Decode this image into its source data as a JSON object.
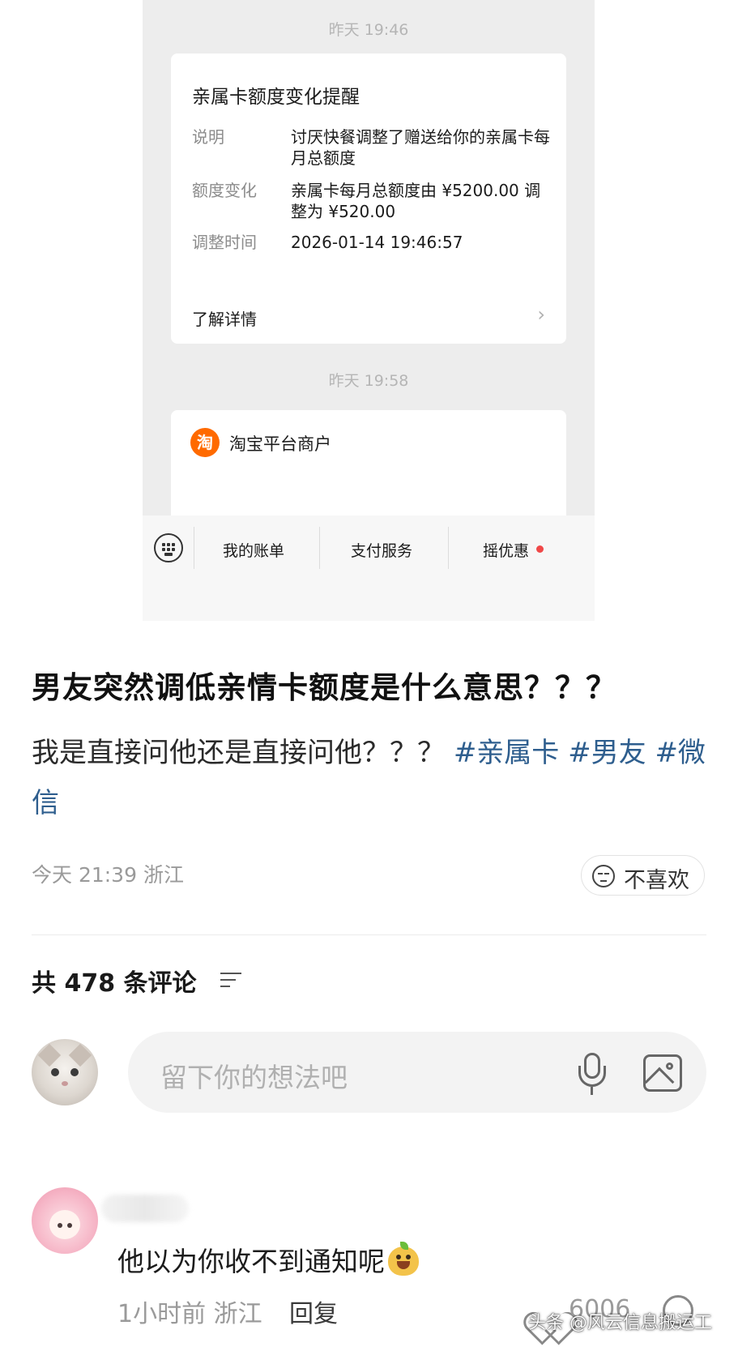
{
  "screenshot": {
    "timestamp1": "昨天 19:46",
    "card": {
      "title": "亲属卡额度变化提醒",
      "rows": [
        {
          "label": "说明",
          "value": "讨厌快餐调整了赠送给你的亲属卡每月总额度"
        },
        {
          "label": "额度变化",
          "value": "亲属卡每月总额度由 ¥5200.00 调整为 ¥520.00"
        },
        {
          "label": "调整时间",
          "value": "2026-01-14 19:46:57"
        }
      ],
      "more_label": "了解详情",
      "more_icon": "chevron-right-icon"
    },
    "timestamp2": "昨天 19:58",
    "merchant": {
      "logo_char": "淘",
      "name": "淘宝平台商户"
    },
    "menu": {
      "keyboard_icon": "keyboard-icon",
      "items": [
        "我的账单",
        "支付服务",
        "摇优惠"
      ]
    }
  },
  "post": {
    "title": "男友突然调低亲情卡额度是什么意思？？？",
    "body": "我是直接问他还是直接问他？？？",
    "tags": [
      "#亲属卡",
      "#男友",
      "#微信"
    ],
    "time": "今天 21:39",
    "location": "浙江",
    "dislike_label": "不喜欢"
  },
  "comments": {
    "count_label": "共 478 条评论",
    "input_placeholder": "留下你的想法吧",
    "items": [
      {
        "text": "他以为你收不到通知呢",
        "time": "1小时前",
        "location": "浙江",
        "reply_label": "回复",
        "likes": "6006"
      }
    ]
  },
  "watermark": "头条 @风云信息搬运工",
  "colors": {
    "tag": "#2e5e8e",
    "taobao": "#ff6a00",
    "red_dot": "#f04848"
  }
}
